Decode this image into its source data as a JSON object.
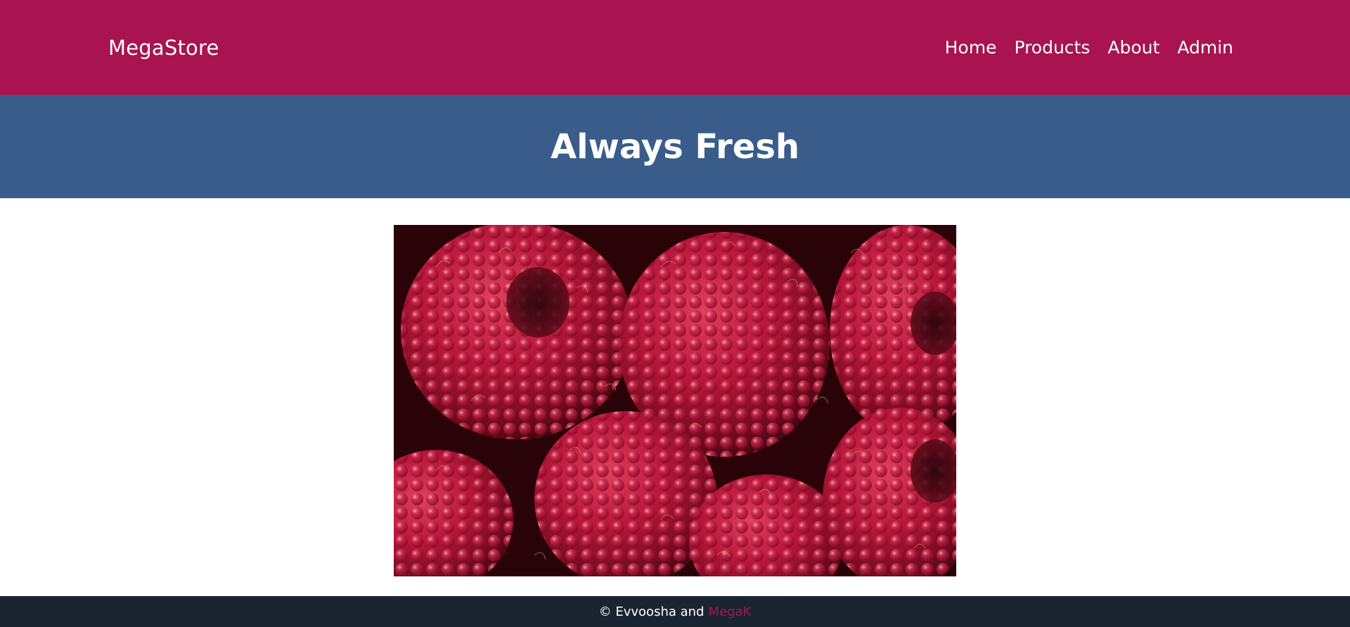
{
  "header": {
    "brand": "MegaStore",
    "nav": [
      {
        "label": "Home"
      },
      {
        "label": "Products"
      },
      {
        "label": "About"
      },
      {
        "label": "Admin"
      }
    ]
  },
  "hero": {
    "title": "Always Fresh"
  },
  "image": {
    "subject": "raspberries-photo"
  },
  "footer": {
    "copyright": "© Evvoosha and",
    "link_text": "MegaK"
  },
  "colors": {
    "navbar": "#a81350",
    "hero": "#395c8b",
    "footer": "#1b2531",
    "accent": "#a81350"
  }
}
